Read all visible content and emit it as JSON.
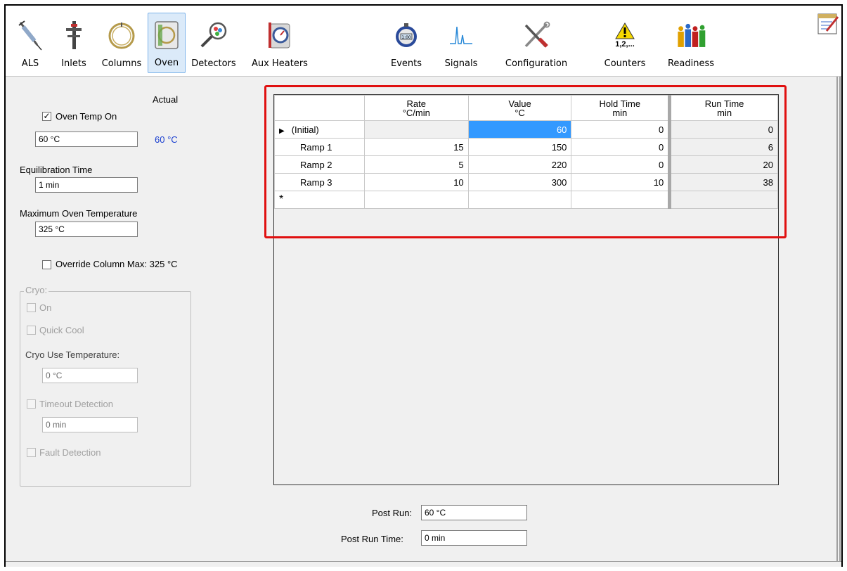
{
  "toolbar": {
    "items": [
      {
        "label": "ALS",
        "icon": "als-syringe-icon"
      },
      {
        "label": "Inlets",
        "icon": "inlet-icon"
      },
      {
        "label": "Columns",
        "icon": "column-coil-icon"
      },
      {
        "label": "Oven",
        "icon": "oven-icon",
        "active": true
      },
      {
        "label": "Detectors",
        "icon": "detector-magnifier-icon"
      },
      {
        "label": "Aux Heaters",
        "icon": "thermometer-gauge-icon"
      },
      {
        "label": "Events",
        "icon": "stopwatch-icon"
      },
      {
        "label": "Signals",
        "icon": "signal-peak-icon"
      },
      {
        "label": "Configuration",
        "icon": "tools-icon"
      },
      {
        "label": "Counters",
        "icon": "warning-counter-icon",
        "icon_text": "1,2,..."
      },
      {
        "label": "Readiness",
        "icon": "people-icon"
      }
    ],
    "notes_icon": "notepad-edit-icon"
  },
  "left_panel": {
    "actual_label": "Actual",
    "oven_temp_on_label": "Oven Temp On",
    "oven_temp_on_checked": true,
    "oven_temp_value": "60 °C",
    "oven_temp_actual": "60 °C",
    "equilibration_label": "Equilibration Time",
    "equilibration_value": "1 min",
    "max_temp_label": "Maximum Oven Temperature",
    "max_temp_value": "325 °C",
    "override_label": "Override Column Max: 325 °C",
    "cryo": {
      "title": "Cryo:",
      "on_label": "On",
      "quick_cool_label": "Quick Cool",
      "use_temp_label": "Cryo Use Temperature:",
      "use_temp_value": "0 °C",
      "timeout_label": "Timeout Detection",
      "timeout_value": "0 min",
      "fault_label": "Fault Detection"
    }
  },
  "ramp_table": {
    "headers": [
      {
        "line1": "Rate",
        "line2": "°C/min"
      },
      {
        "line1": "Value",
        "line2": "°C"
      },
      {
        "line1": "Hold Time",
        "line2": "min"
      },
      {
        "line1": "Run Time",
        "line2": "min"
      }
    ],
    "rows": [
      {
        "name": "(Initial)",
        "rate": "",
        "value": "60",
        "hold": "0",
        "run": "0",
        "current": true
      },
      {
        "name": "Ramp 1",
        "rate": "15",
        "value": "150",
        "hold": "0",
        "run": "6"
      },
      {
        "name": "Ramp 2",
        "rate": "5",
        "value": "220",
        "hold": "0",
        "run": "20"
      },
      {
        "name": "Ramp 3",
        "rate": "10",
        "value": "300",
        "hold": "10",
        "run": "38"
      }
    ],
    "new_row_marker": "*",
    "current_row_marker": "▶"
  },
  "post_run": {
    "post_run_label": "Post Run:",
    "post_run_value": "60 °C",
    "post_run_time_label": "Post Run Time:",
    "post_run_time_value": "0 min"
  }
}
